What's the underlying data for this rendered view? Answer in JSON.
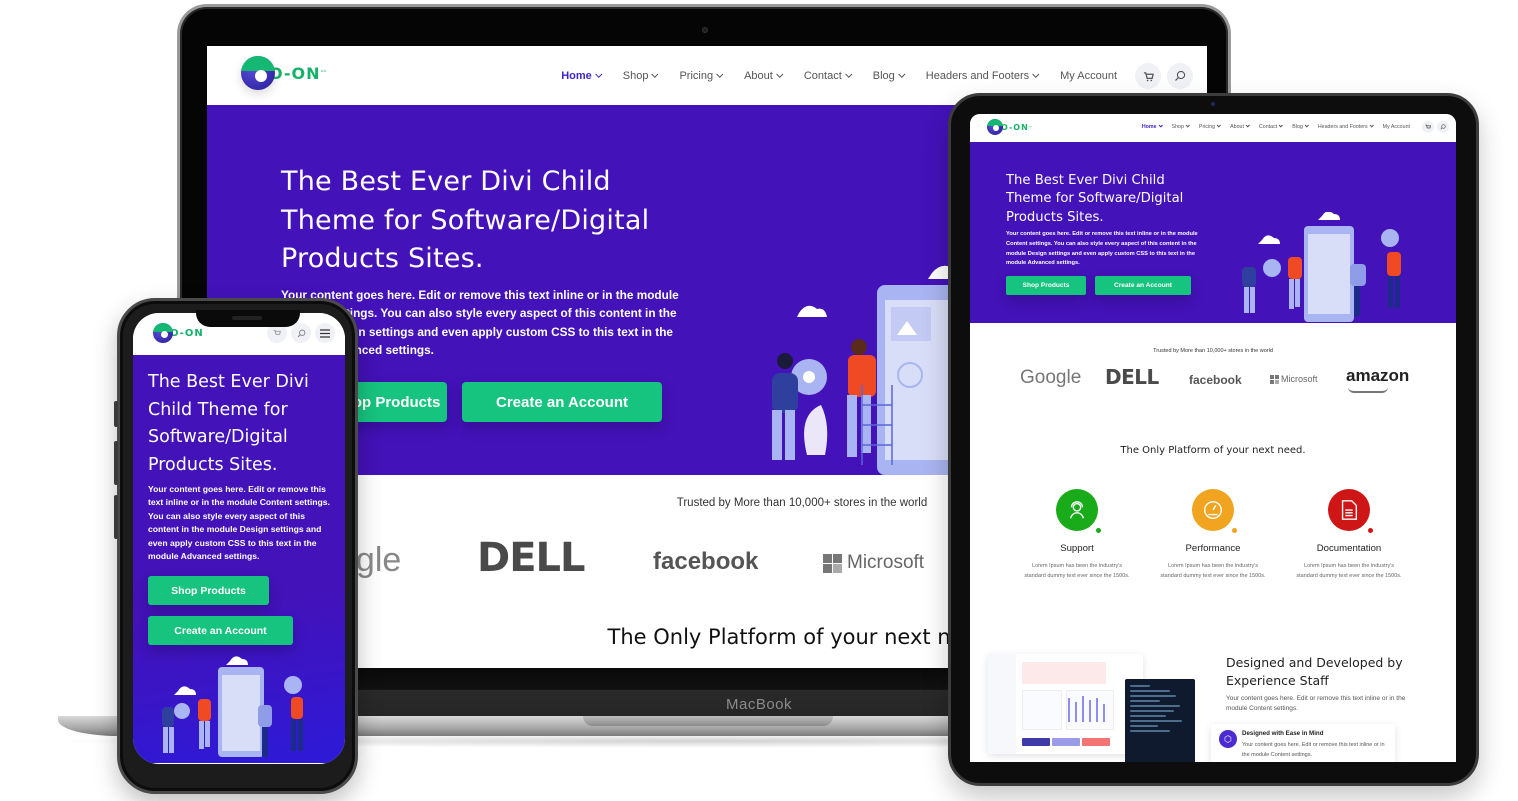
{
  "brand": {
    "logo_text": "O-ON",
    "logo_sup": "°°",
    "primary_color": "#4312b9",
    "accent_color": "#17c47f",
    "nav_active_color": "#4125c8"
  },
  "nav": {
    "items": [
      {
        "label": "Home",
        "has_dropdown": true,
        "active": true
      },
      {
        "label": "Shop",
        "has_dropdown": true
      },
      {
        "label": "Pricing",
        "has_dropdown": true
      },
      {
        "label": "About",
        "has_dropdown": true
      },
      {
        "label": "Contact",
        "has_dropdown": true
      },
      {
        "label": "Blog",
        "has_dropdown": true
      },
      {
        "label": "Headers and Footers",
        "has_dropdown": true
      },
      {
        "label": "My Account",
        "has_dropdown": false
      }
    ],
    "cart_icon": "cart-icon",
    "search_icon": "search-icon",
    "menu_icon": "hamburger-menu-icon"
  },
  "hero": {
    "title_desktop": "The Best Ever Divi Child Theme for Software/Digital Products Sites.",
    "title_phone": "The Best Ever Divi Child Theme for Software/Digital Products Sites.",
    "body": "Your content goes here. Edit or remove this text inline or in the module Content settings. You can also style every aspect of this content in the module Design settings and even apply custom CSS to this text in the module Advanced settings.",
    "body_desktop_visible": "Your content goes here. Edit or remove this text inline or in the module Content settings. You can also style every aspect of this content in the module Design settings and even apply custom CSS to this text in the module Advanced settings.",
    "shop_button": "Shop Products",
    "shop_button_partial": "Products",
    "create_button": "Create an Account"
  },
  "trust": {
    "title": "Trusted by More than 10,000+ stores in the world",
    "logos": [
      "Google",
      "DELL",
      "facebook",
      "Microsoft",
      "amazon"
    ],
    "google_partial": "ogle"
  },
  "platform": {
    "title": "The Only Platform of your next need."
  },
  "features": [
    {
      "title": "Support",
      "description": "Lorem Ipsum has been the industry's standard dummy text ever since the 1500s.",
      "color": "#1aab1a",
      "icon": "headset-support-icon"
    },
    {
      "title": "Performance",
      "description": "Lorem Ipsum has been the industry's standard dummy text ever since the 1500s.",
      "color": "#f0a41f",
      "icon": "speedometer-icon"
    },
    {
      "title": "Documentation",
      "description": "Lorem Ipsum has been the industry's standard dummy text ever since the 1500s.",
      "color": "#cf1616",
      "icon": "document-icon"
    }
  ],
  "design_section": {
    "title": "Designed and Developed by Experience Staff",
    "description": "Your content goes here. Edit or remove this text inline or in the module Content settings.",
    "card_title": "Designed with Ease in Mind",
    "card_description": "Your content goes here. Edit or remove this text inline or in the module Content settings."
  },
  "devices": {
    "laptop_brand": "MacBook"
  }
}
